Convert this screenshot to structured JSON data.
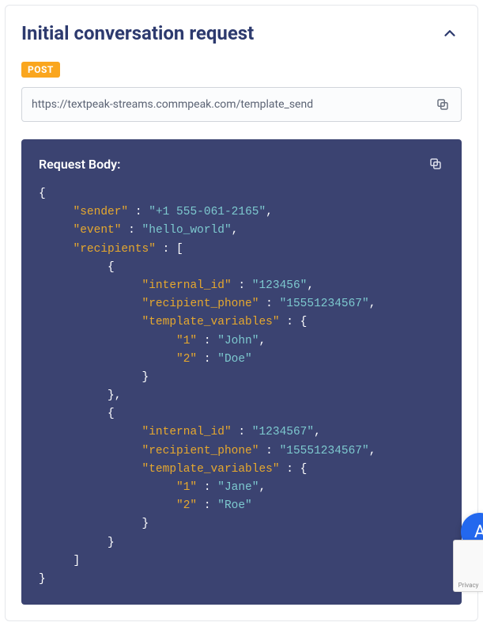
{
  "section": {
    "title": "Initial conversation request",
    "method_badge": "POST",
    "url": "https://textpeak-streams.commpeak.com/template_send"
  },
  "request_body": {
    "label": "Request Body:",
    "json": {
      "sender": "+1 555-061-2165",
      "event": "hello_world",
      "recipients": [
        {
          "internal_id": "123456",
          "recipient_phone": "15551234567",
          "template_variables": {
            "1": "John",
            "2": "Doe"
          }
        },
        {
          "internal_id": "1234567",
          "recipient_phone": "15551234567",
          "template_variables": {
            "1": "Jane",
            "2": "Roe"
          }
        }
      ]
    }
  },
  "recaptcha_label": "Privacy"
}
